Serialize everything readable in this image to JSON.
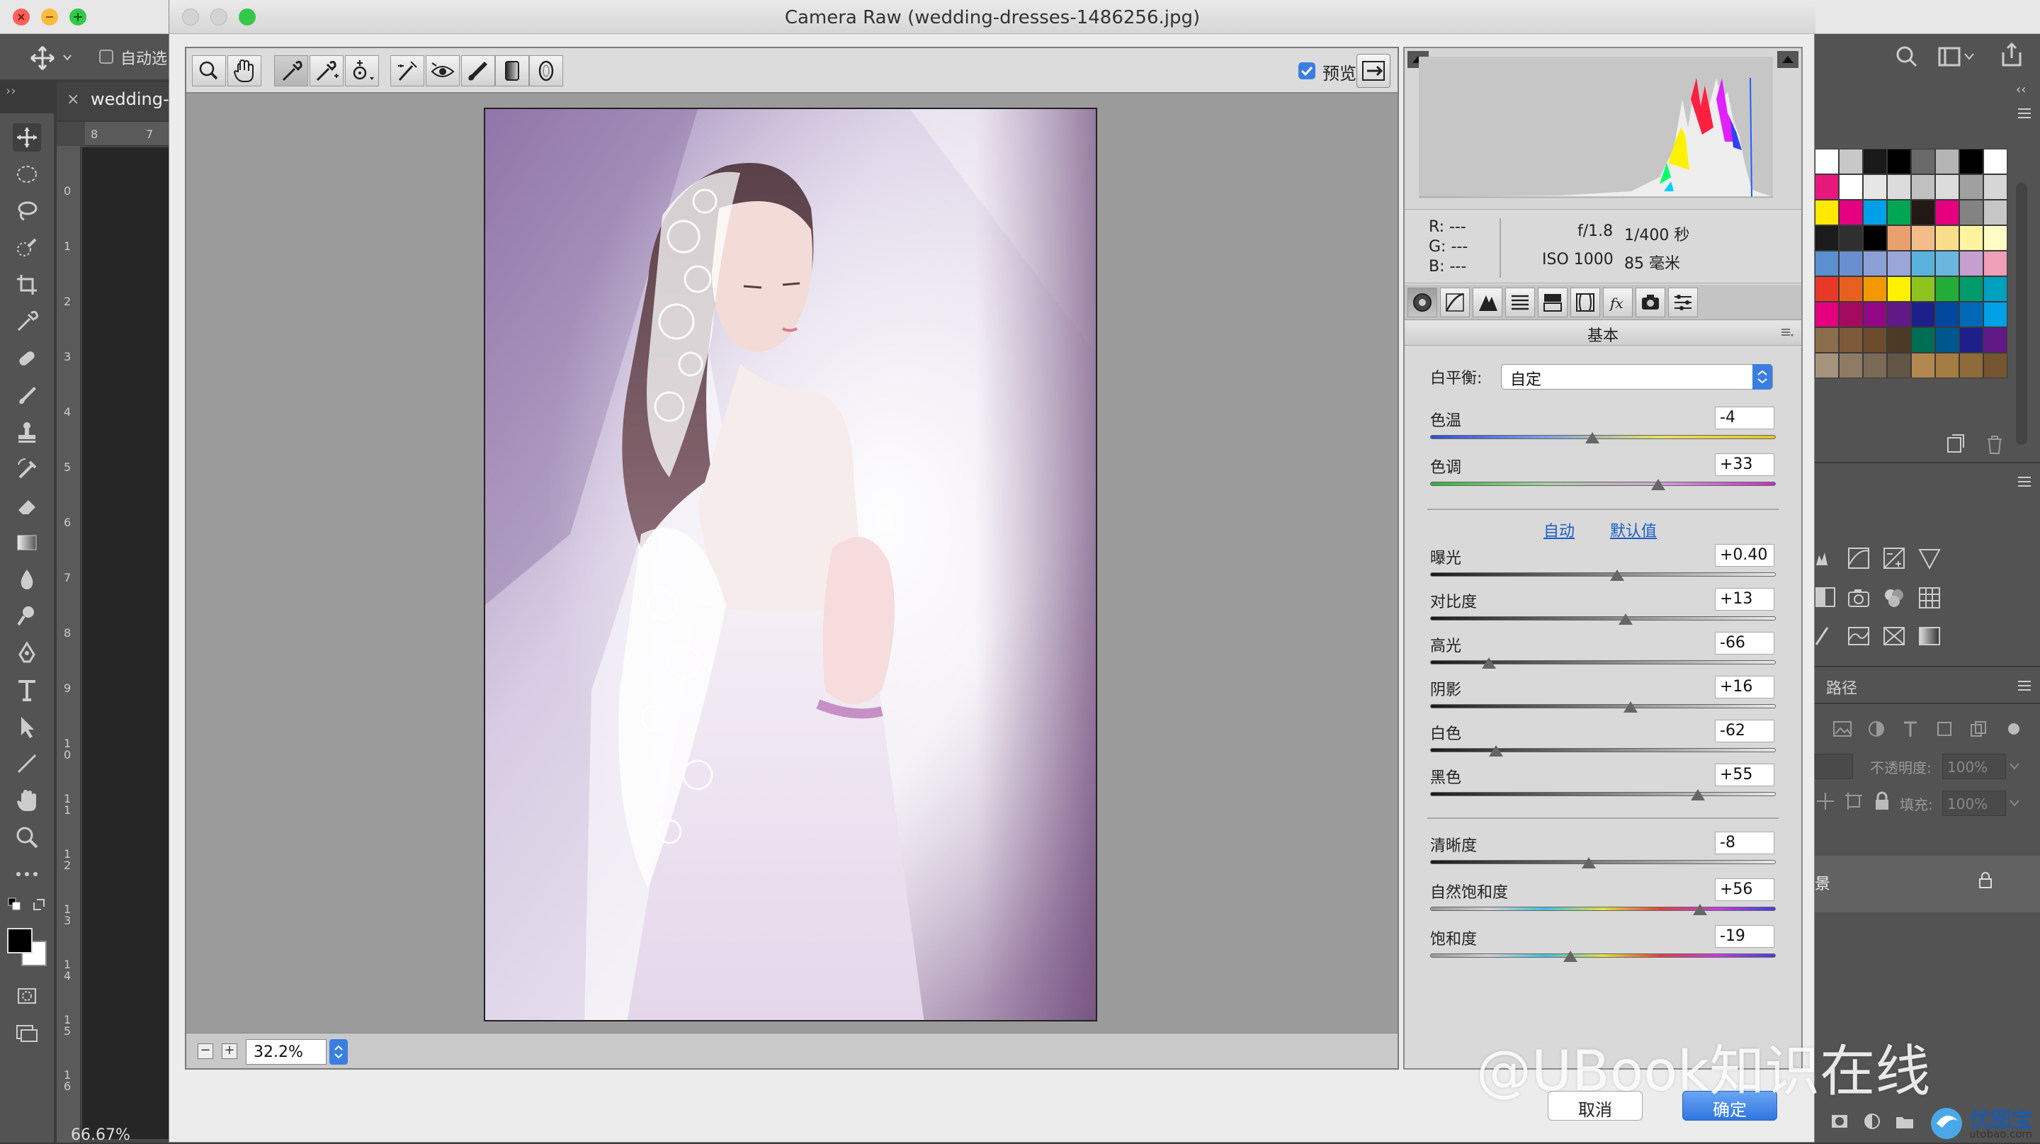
{
  "ps": {
    "options": {
      "auto_select_label": "自动选"
    },
    "tab": {
      "close": "×",
      "name": "wedding-"
    },
    "left_collapse": "››",
    "right_collapse": "‹‹",
    "ruler_h_labels": [
      "8",
      "7"
    ],
    "ruler_v_labels": [
      "0",
      "1",
      "2",
      "3",
      "4",
      "5",
      "6",
      "7",
      "8",
      "9",
      "1\n0",
      "1\n1",
      "1\n2",
      "1\n3",
      "1\n4",
      "1\n5",
      "1\n6"
    ],
    "status_zoom": "66.67%",
    "right_panel": {
      "paths_tab": "路径",
      "opacity_label": "不透明度:",
      "opacity_value": "100%",
      "fill_label": "填充:",
      "fill_value": "100%",
      "layer_char": "景"
    },
    "swatch_colors": [
      "#ffffff",
      "#c8c8c8",
      "#1a1a1a",
      "#000000",
      "#6a6a6a",
      "#b4b4b4",
      "#000000",
      "#ffffff",
      "#e7187c",
      "#ffffff",
      "#e6e6e6",
      "#dcdcdc",
      "#c0c0c0",
      "#dcdcdc",
      "#a0a0a0",
      "#d6d6d6",
      "#ffe800",
      "#e40081",
      "#00a0e9",
      "#00a651",
      "#231815",
      "#e4007f",
      "#838383",
      "#c6c6c6",
      "#1b1b1b",
      "#2f2f2f",
      "#000000",
      "#eaa06e",
      "#f3bd8a",
      "#f8dd8a",
      "#fff3a0",
      "#fffbc4",
      "#5a8fd0",
      "#6a8fd0",
      "#8c9fd6",
      "#9aa6d8",
      "#58b2dc",
      "#6bb6e0",
      "#c59fd0",
      "#f09fb8",
      "#e83828",
      "#e86020",
      "#f39800",
      "#fff100",
      "#8fc31f",
      "#22ac38",
      "#009b6b",
      "#00a0c1",
      "#e4007f",
      "#a40b5e",
      "#920783",
      "#601986",
      "#1d2088",
      "#00479d",
      "#0068b7",
      "#00a0e9",
      "#8a6e4b",
      "#7e5a3a",
      "#6a4b2c",
      "#4d3a26",
      "#006e54",
      "#00568f",
      "#1d2088",
      "#601986",
      "#a6937c",
      "#8e7b64",
      "#7a6a56",
      "#625545",
      "#b28850",
      "#a57c42",
      "#8e6b3a",
      "#745530"
    ]
  },
  "dialog": {
    "title": "Camera Raw (wedding-dresses-1486256.jpg)",
    "preview_label": "预览",
    "zoom": {
      "minus": "−",
      "plus": "+",
      "value": "32.2%"
    },
    "info": {
      "r": "R:  ---",
      "g": "G:  ---",
      "b": "B:  ---",
      "aperture": "f/1.8",
      "shutter": "1/400 秒",
      "iso": "ISO 1000",
      "focal": "85 毫米"
    },
    "panel": {
      "header": "基本",
      "menu_icon": "☰",
      "wb_label": "白平衡:",
      "wb_value": "自定",
      "auto_link": "自动",
      "default_link": "默认值"
    },
    "buttons": {
      "cancel": "取消",
      "ok": "确定"
    }
  },
  "sliders": [
    {
      "label": "色温",
      "value": "-4",
      "position": 0.47,
      "track": "temp"
    },
    {
      "label": "色调",
      "value": "+33",
      "position": 0.66,
      "track": "tint"
    },
    {
      "label": "曝光",
      "value": "+0.40",
      "position": 0.54,
      "track": "gray"
    },
    {
      "label": "对比度",
      "value": "+13",
      "position": 0.565,
      "track": "gray"
    },
    {
      "label": "高光",
      "value": "-66",
      "position": 0.17,
      "track": "gray"
    },
    {
      "label": "阴影",
      "value": "+16",
      "position": 0.58,
      "track": "gray"
    },
    {
      "label": "白色",
      "value": "-62",
      "position": 0.19,
      "track": "gray"
    },
    {
      "label": "黑色",
      "value": "+55",
      "position": 0.775,
      "track": "gray"
    },
    {
      "label": "清晰度",
      "value": "-8",
      "position": 0.46,
      "track": "gray"
    },
    {
      "label": "自然饱和度",
      "value": "+56",
      "position": 0.78,
      "track": "sat"
    },
    {
      "label": "饱和度",
      "value": "-19",
      "position": 0.405,
      "track": "sat"
    }
  ],
  "watermark": "@UBook知识在线",
  "logo": {
    "text": "优图宝",
    "url": "utobao.com"
  }
}
